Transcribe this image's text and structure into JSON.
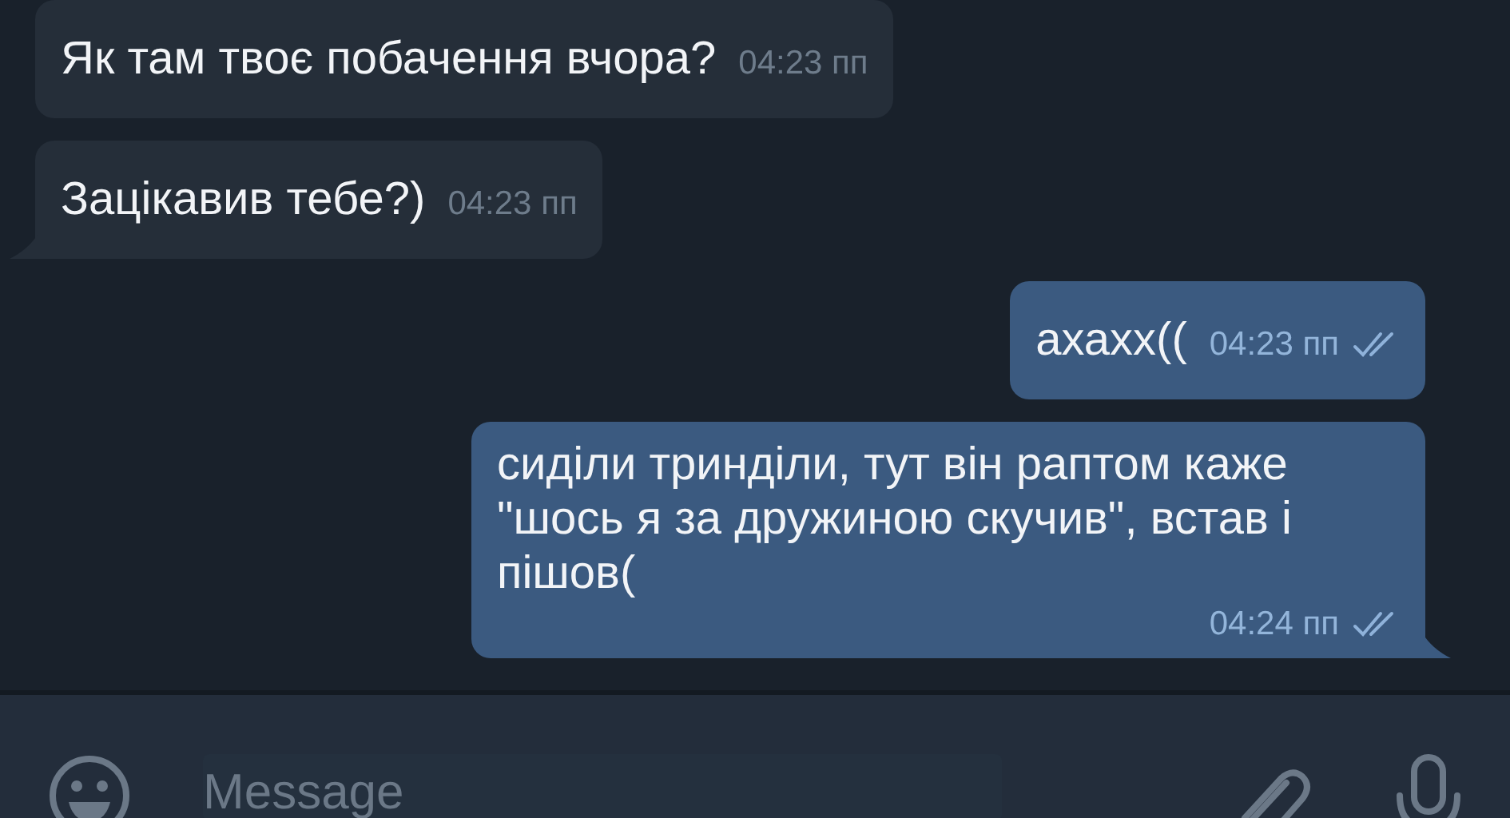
{
  "messages": [
    {
      "kind": "incoming",
      "text": "Як там твоє побачення вчора?",
      "time": "04:23 пп",
      "tail": false
    },
    {
      "kind": "incoming",
      "text": "Зацікавив тебе?)",
      "time": "04:23 пп",
      "tail": true
    },
    {
      "kind": "outgoing",
      "text": "ахахх((",
      "time": "04:23 пп",
      "read": true,
      "tail": false
    },
    {
      "kind": "outgoing",
      "text": "сиділи тринділи, тут він раптом каже \"шось я за дружиною скучив\", встав і пішов(",
      "time": "04:24 пп",
      "read": true,
      "tail": true
    }
  ],
  "composer": {
    "placeholder": "Message"
  }
}
